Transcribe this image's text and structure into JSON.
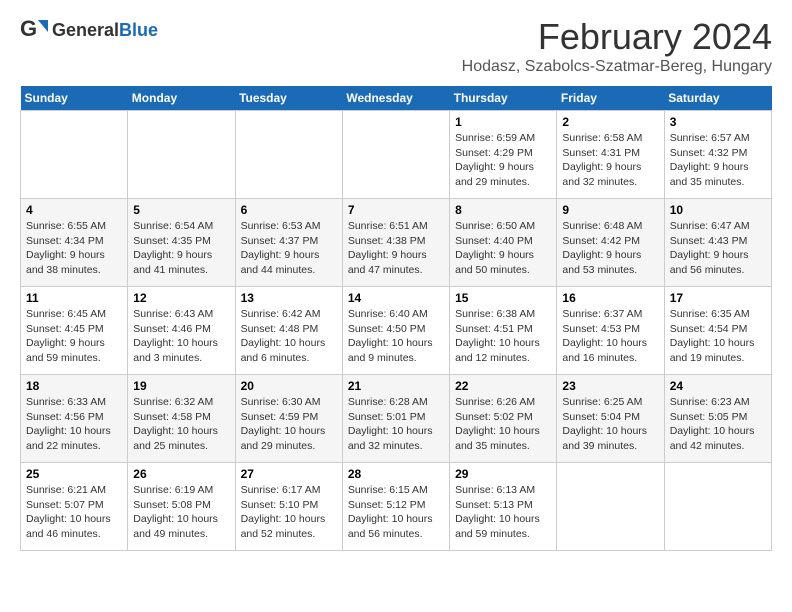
{
  "header": {
    "logo_general": "General",
    "logo_blue": "Blue",
    "month_title": "February 2024",
    "subtitle": "Hodasz, Szabolcs-Szatmar-Bereg, Hungary"
  },
  "days_of_week": [
    "Sunday",
    "Monday",
    "Tuesday",
    "Wednesday",
    "Thursday",
    "Friday",
    "Saturday"
  ],
  "weeks": [
    [
      {
        "day": "",
        "info": ""
      },
      {
        "day": "",
        "info": ""
      },
      {
        "day": "",
        "info": ""
      },
      {
        "day": "",
        "info": ""
      },
      {
        "day": "1",
        "info": "Sunrise: 6:59 AM\nSunset: 4:29 PM\nDaylight: 9 hours\nand 29 minutes."
      },
      {
        "day": "2",
        "info": "Sunrise: 6:58 AM\nSunset: 4:31 PM\nDaylight: 9 hours\nand 32 minutes."
      },
      {
        "day": "3",
        "info": "Sunrise: 6:57 AM\nSunset: 4:32 PM\nDaylight: 9 hours\nand 35 minutes."
      }
    ],
    [
      {
        "day": "4",
        "info": "Sunrise: 6:55 AM\nSunset: 4:34 PM\nDaylight: 9 hours\nand 38 minutes."
      },
      {
        "day": "5",
        "info": "Sunrise: 6:54 AM\nSunset: 4:35 PM\nDaylight: 9 hours\nand 41 minutes."
      },
      {
        "day": "6",
        "info": "Sunrise: 6:53 AM\nSunset: 4:37 PM\nDaylight: 9 hours\nand 44 minutes."
      },
      {
        "day": "7",
        "info": "Sunrise: 6:51 AM\nSunset: 4:38 PM\nDaylight: 9 hours\nand 47 minutes."
      },
      {
        "day": "8",
        "info": "Sunrise: 6:50 AM\nSunset: 4:40 PM\nDaylight: 9 hours\nand 50 minutes."
      },
      {
        "day": "9",
        "info": "Sunrise: 6:48 AM\nSunset: 4:42 PM\nDaylight: 9 hours\nand 53 minutes."
      },
      {
        "day": "10",
        "info": "Sunrise: 6:47 AM\nSunset: 4:43 PM\nDaylight: 9 hours\nand 56 minutes."
      }
    ],
    [
      {
        "day": "11",
        "info": "Sunrise: 6:45 AM\nSunset: 4:45 PM\nDaylight: 9 hours\nand 59 minutes."
      },
      {
        "day": "12",
        "info": "Sunrise: 6:43 AM\nSunset: 4:46 PM\nDaylight: 10 hours\nand 3 minutes."
      },
      {
        "day": "13",
        "info": "Sunrise: 6:42 AM\nSunset: 4:48 PM\nDaylight: 10 hours\nand 6 minutes."
      },
      {
        "day": "14",
        "info": "Sunrise: 6:40 AM\nSunset: 4:50 PM\nDaylight: 10 hours\nand 9 minutes."
      },
      {
        "day": "15",
        "info": "Sunrise: 6:38 AM\nSunset: 4:51 PM\nDaylight: 10 hours\nand 12 minutes."
      },
      {
        "day": "16",
        "info": "Sunrise: 6:37 AM\nSunset: 4:53 PM\nDaylight: 10 hours\nand 16 minutes."
      },
      {
        "day": "17",
        "info": "Sunrise: 6:35 AM\nSunset: 4:54 PM\nDaylight: 10 hours\nand 19 minutes."
      }
    ],
    [
      {
        "day": "18",
        "info": "Sunrise: 6:33 AM\nSunset: 4:56 PM\nDaylight: 10 hours\nand 22 minutes."
      },
      {
        "day": "19",
        "info": "Sunrise: 6:32 AM\nSunset: 4:58 PM\nDaylight: 10 hours\nand 25 minutes."
      },
      {
        "day": "20",
        "info": "Sunrise: 6:30 AM\nSunset: 4:59 PM\nDaylight: 10 hours\nand 29 minutes."
      },
      {
        "day": "21",
        "info": "Sunrise: 6:28 AM\nSunset: 5:01 PM\nDaylight: 10 hours\nand 32 minutes."
      },
      {
        "day": "22",
        "info": "Sunrise: 6:26 AM\nSunset: 5:02 PM\nDaylight: 10 hours\nand 35 minutes."
      },
      {
        "day": "23",
        "info": "Sunrise: 6:25 AM\nSunset: 5:04 PM\nDaylight: 10 hours\nand 39 minutes."
      },
      {
        "day": "24",
        "info": "Sunrise: 6:23 AM\nSunset: 5:05 PM\nDaylight: 10 hours\nand 42 minutes."
      }
    ],
    [
      {
        "day": "25",
        "info": "Sunrise: 6:21 AM\nSunset: 5:07 PM\nDaylight: 10 hours\nand 46 minutes."
      },
      {
        "day": "26",
        "info": "Sunrise: 6:19 AM\nSunset: 5:08 PM\nDaylight: 10 hours\nand 49 minutes."
      },
      {
        "day": "27",
        "info": "Sunrise: 6:17 AM\nSunset: 5:10 PM\nDaylight: 10 hours\nand 52 minutes."
      },
      {
        "day": "28",
        "info": "Sunrise: 6:15 AM\nSunset: 5:12 PM\nDaylight: 10 hours\nand 56 minutes."
      },
      {
        "day": "29",
        "info": "Sunrise: 6:13 AM\nSunset: 5:13 PM\nDaylight: 10 hours\nand 59 minutes."
      },
      {
        "day": "",
        "info": ""
      },
      {
        "day": "",
        "info": ""
      }
    ]
  ]
}
